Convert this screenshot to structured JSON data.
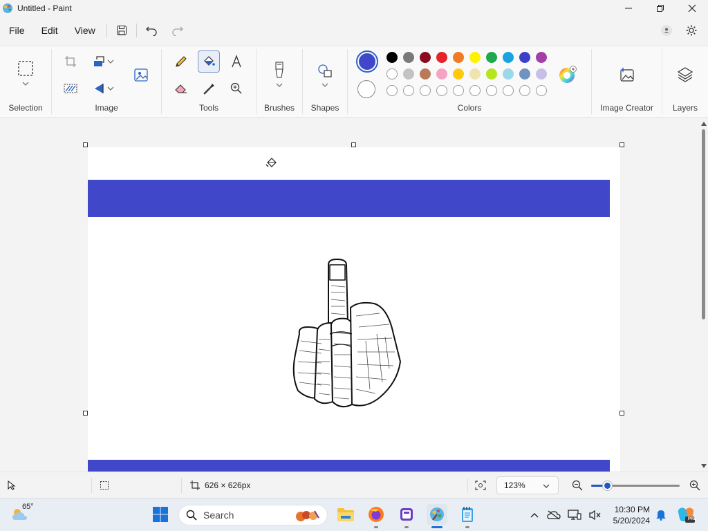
{
  "window": {
    "title": "Untitled - Paint"
  },
  "menu": {
    "file": "File",
    "edit": "Edit",
    "view": "View"
  },
  "ribbon": {
    "groups": {
      "selection": "Selection",
      "image": "Image",
      "tools": "Tools",
      "brushes": "Brushes",
      "shapes": "Shapes",
      "colors": "Colors",
      "image_creator": "Image Creator",
      "layers": "Layers"
    },
    "primary_color": "#4147c9",
    "secondary_color": "#ffffff",
    "palette_row1": [
      "#000000",
      "#7a7a7a",
      "#8b0c1e",
      "#e3242b",
      "#f27a24",
      "#fff200",
      "#1fa84c",
      "#1aa3de",
      "#3c40c8",
      "#a43fa7"
    ],
    "palette_row2": [
      "#ffffff",
      "#c3c3c3",
      "#b97a57",
      "#f5a3c4",
      "#ffc90e",
      "#efe4b0",
      "#b5e61d",
      "#99d9ea",
      "#7092be",
      "#c8bfe7"
    ],
    "palette_row3_empty": 10
  },
  "canvas": {
    "band_color": "#4147c9"
  },
  "status": {
    "dimensions": "626 × 626px",
    "zoom": "123%"
  },
  "taskbar": {
    "search_placeholder": "Search",
    "weather_temp": "65°",
    "time": "10:30 PM",
    "date": "5/20/2024"
  }
}
